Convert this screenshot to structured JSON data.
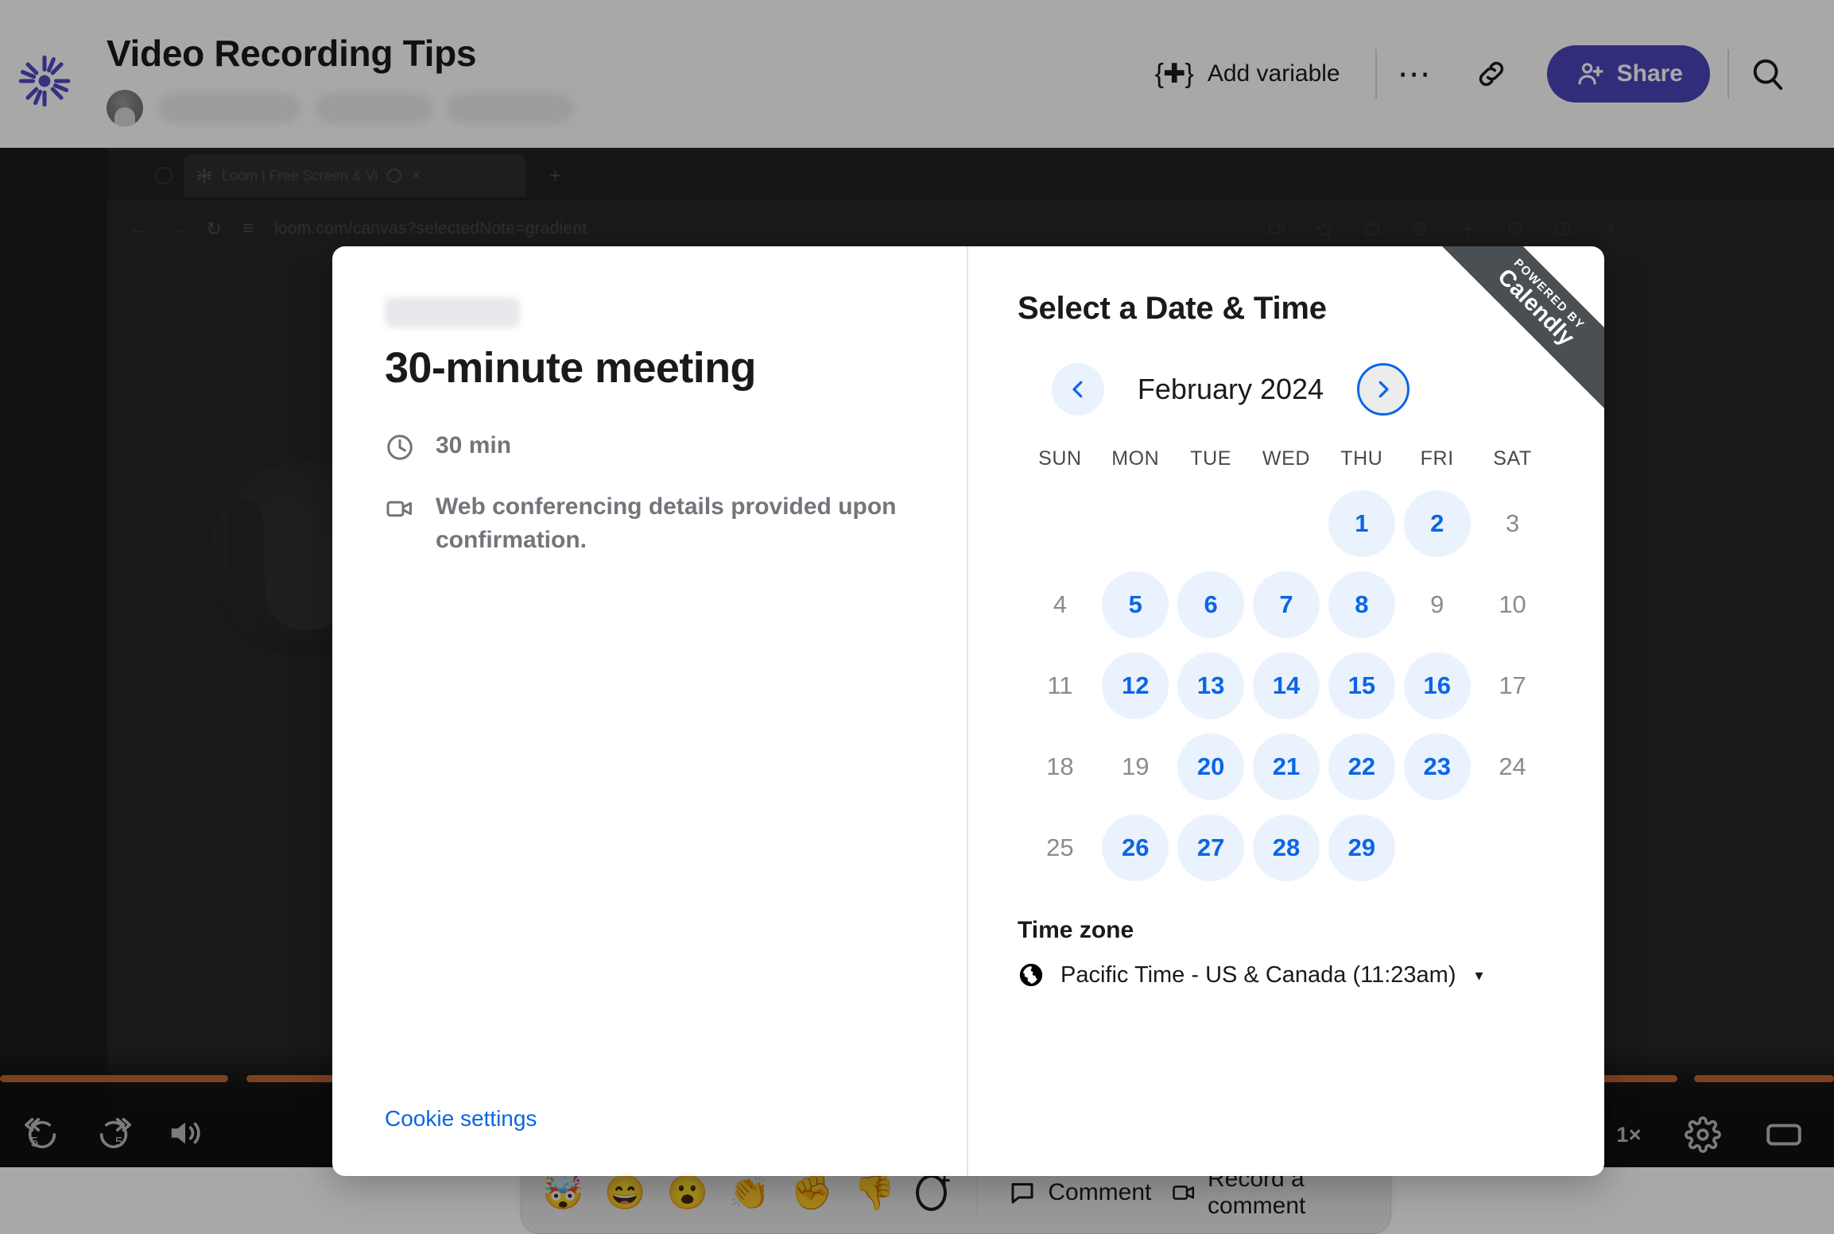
{
  "header": {
    "logo_icon": "loom-logo-icon",
    "title": "Video Recording Tips",
    "add_variable_label": "Add variable",
    "add_variable_icon": "curly-brace-plus-icon",
    "more_icon": "ellipsis-icon",
    "link_icon": "link-icon",
    "share_label": "Share",
    "share_icon": "add-person-icon",
    "search_icon": "search-icon",
    "share_color": "#4b45ba"
  },
  "video": {
    "browser_tab_title": "Loom | Free Screen & Vi",
    "url": "loom.com/canvas?selectedNote=gradient",
    "new_tab_icon": "plus-icon",
    "close_tab_icon": "close-icon",
    "reload_icon": "reload-icon",
    "back_icon": "back-arrow-icon",
    "forward_icon": "forward-arrow-icon"
  },
  "player": {
    "rewind_label": "5",
    "rewind_icon": "rewind-5-icon",
    "forward_label": "5",
    "forward_icon": "forward-5-icon",
    "volume_icon": "volume-icon",
    "speed_label": "1×",
    "settings_icon": "gear-icon",
    "theater_icon": "theater-mode-icon",
    "progress_color": "#bf6330"
  },
  "reactions": {
    "emojis": [
      "🤯",
      "😄",
      "😮",
      "👏",
      "✊",
      "👎"
    ],
    "picker_icon": "add-reaction-icon",
    "comment_label": "Comment",
    "comment_icon": "comment-bubble-icon",
    "record_comment_label": "Record a comment",
    "record_comment_icon": "video-camera-icon"
  },
  "modal": {
    "ribbon": {
      "line1": "POWERED BY",
      "line2": "Calendly"
    },
    "left": {
      "event_title": "30-minute meeting",
      "duration": "30 min",
      "duration_icon": "clock-icon",
      "location": "Web conferencing details provided upon confirmation.",
      "location_icon": "video-camera-icon",
      "cookie_link": "Cookie settings"
    },
    "right": {
      "heading": "Select a Date & Time",
      "prev_icon": "chevron-left-icon",
      "next_icon": "chevron-right-icon",
      "month_label": "February 2024",
      "weekdays": [
        "SUN",
        "MON",
        "TUE",
        "WED",
        "THU",
        "FRI",
        "SAT"
      ],
      "leading_blanks": 4,
      "days": [
        {
          "n": "1",
          "available": true
        },
        {
          "n": "2",
          "available": true
        },
        {
          "n": "3",
          "available": false
        },
        {
          "n": "4",
          "available": false
        },
        {
          "n": "5",
          "available": true
        },
        {
          "n": "6",
          "available": true
        },
        {
          "n": "7",
          "available": true
        },
        {
          "n": "8",
          "available": true
        },
        {
          "n": "9",
          "available": false
        },
        {
          "n": "10",
          "available": false
        },
        {
          "n": "11",
          "available": false
        },
        {
          "n": "12",
          "available": true
        },
        {
          "n": "13",
          "available": true
        },
        {
          "n": "14",
          "available": true
        },
        {
          "n": "15",
          "available": true
        },
        {
          "n": "16",
          "available": true
        },
        {
          "n": "17",
          "available": false
        },
        {
          "n": "18",
          "available": false
        },
        {
          "n": "19",
          "available": false
        },
        {
          "n": "20",
          "available": true
        },
        {
          "n": "21",
          "available": true
        },
        {
          "n": "22",
          "available": true
        },
        {
          "n": "23",
          "available": true
        },
        {
          "n": "24",
          "available": false
        },
        {
          "n": "25",
          "available": false
        },
        {
          "n": "26",
          "available": true
        },
        {
          "n": "27",
          "available": true
        },
        {
          "n": "28",
          "available": true
        },
        {
          "n": "29",
          "available": true
        }
      ],
      "timezone_title": "Time zone",
      "timezone_value": "Pacific Time - US & Canada (11:23am)",
      "timezone_icon": "globe-icon",
      "timezone_caret": "▾",
      "accent_color": "#0b66e4",
      "available_bg": "#eaf2fd"
    }
  }
}
